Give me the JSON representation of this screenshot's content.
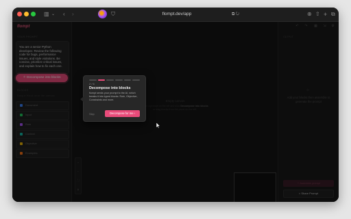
{
  "browser": {
    "url": "flompt.dev/app"
  },
  "app": {
    "logo": "flompt"
  },
  "sidebar": {
    "prompt_label": "Your prompt",
    "prompt_text": "You are a senior Python developer. Review the following code for bugs, performance issues, and style violations. Be concise, prioritize critical issues, and explain how to fix each one.",
    "decompose_button": "Decompose into blocks",
    "blocks_label": "Blocks",
    "blocks_hint": "Drag a block onto the canvas",
    "blocks": [
      {
        "label": "Document",
        "color": "#3b82f6"
      },
      {
        "label": "Input",
        "color": "#22c55e"
      },
      {
        "label": "Role",
        "color": "#a855f7"
      },
      {
        "label": "Context",
        "color": "#14b8a6"
      },
      {
        "label": "Objective",
        "color": "#eab308"
      },
      {
        "label": "Examples",
        "color": "#f97316"
      }
    ]
  },
  "canvas": {
    "empty_title": "Empty canvas",
    "empty_text_1": "Paste a prompt on the left and click",
    "empty_text_highlight": "Decompose into blocks",
    "empty_text_2": "or drag blocks from the panel on the left."
  },
  "right_panel": {
    "label": "Output",
    "empty_text": "Add your blocks then assemble to generate the prompt",
    "assemble_button": "Assemble prompt",
    "share_button": "Share Prompt"
  },
  "onboarding": {
    "step": "2 / 6",
    "title": "Decompose into blocks",
    "description": "flompt sends your prompt to the AI, which breaks it into typed blocks: Role, Objective, Constraints and more.",
    "skip": "Skip",
    "cta": "Decompose for me",
    "steps_total": 6,
    "steps_active": 2
  }
}
